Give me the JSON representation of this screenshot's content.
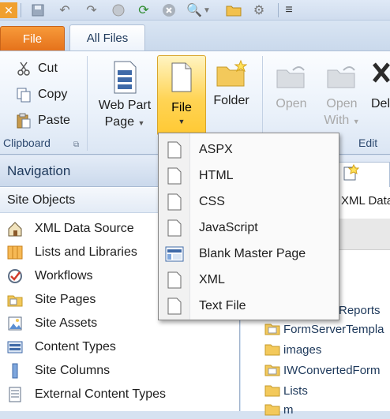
{
  "ribbon": {
    "tabs": {
      "file": "File",
      "all_files": "All Files"
    },
    "clipboard": {
      "cut": "Cut",
      "copy": "Copy",
      "paste": "Paste",
      "group_label": "Clipboard"
    },
    "new": {
      "web_part_page_line1": "Web Part",
      "web_part_page_line2": "Page",
      "file": "File",
      "folder": "Folder"
    },
    "edit": {
      "open": "Open",
      "open_with_line1": "Open",
      "open_with_line2": "With",
      "delete_partial": "Del",
      "group_label": "Edit"
    }
  },
  "navigation": {
    "title": "Navigation",
    "section": "Site Objects",
    "items": [
      {
        "label": "XML Data Source",
        "icon": "xml-data-source-icon"
      },
      {
        "label": "Lists and Libraries",
        "icon": "lists-libraries-icon"
      },
      {
        "label": "Workflows",
        "icon": "workflows-icon"
      },
      {
        "label": "Site Pages",
        "icon": "site-pages-icon"
      },
      {
        "label": "Site Assets",
        "icon": "site-assets-icon"
      },
      {
        "label": "Content Types",
        "icon": "content-types-icon"
      },
      {
        "label": "Site Columns",
        "icon": "site-columns-icon"
      },
      {
        "label": "External Content Types",
        "icon": "external-content-types-icon"
      }
    ]
  },
  "right_pane": {
    "tab_partial": "XML Data",
    "tree": [
      "Reports",
      "FormServerTempla",
      "images",
      "IWConvertedForm",
      "Lists",
      "m"
    ]
  },
  "file_menu": {
    "items": [
      "ASPX",
      "HTML",
      "CSS",
      "JavaScript",
      "Blank Master Page",
      "XML",
      "Text File"
    ]
  },
  "colors": {
    "accent": "#e5721b",
    "highlight": "#ffd455",
    "ribbon_bg": "#eaf1fa",
    "link": "#1e395b"
  }
}
